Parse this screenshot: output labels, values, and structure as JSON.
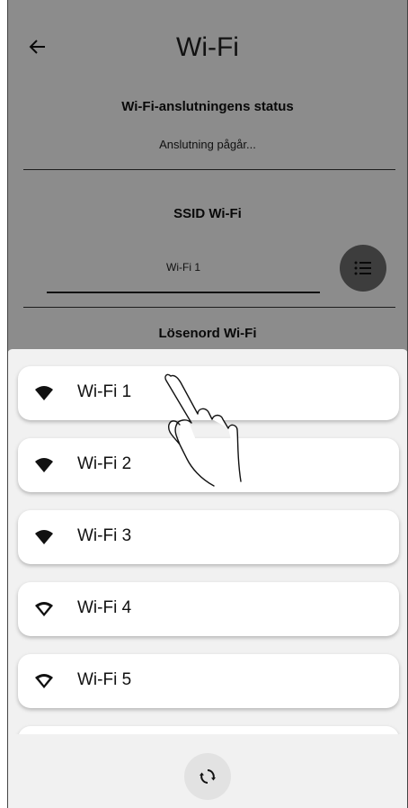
{
  "header": {
    "title": "Wi-Fi"
  },
  "status": {
    "label": "Wi-Fi-anslutningens status",
    "value": "Anslutning pågår..."
  },
  "ssid": {
    "label": "SSID Wi-Fi",
    "value": "Wi-Fi 1"
  },
  "password": {
    "label": "Lösenord Wi-Fi"
  },
  "networks": [
    {
      "label": "Wi-Fi 1",
      "icon": "wifi-filled-icon"
    },
    {
      "label": "Wi-Fi 2",
      "icon": "wifi-filled-icon"
    },
    {
      "label": "Wi-Fi 3",
      "icon": "wifi-filled-icon"
    },
    {
      "label": "Wi-Fi 4",
      "icon": "wifi-outline-icon"
    },
    {
      "label": "Wi-Fi 5",
      "icon": "wifi-outline-icon"
    }
  ],
  "icons": {
    "back": "arrow-left-icon",
    "list": "list-icon",
    "refresh": "refresh-icon",
    "gesture": "tap-hand-icon"
  },
  "colors": {
    "overlay": "#737373",
    "sheet": "#f1f1f1",
    "card": "#ffffff"
  }
}
